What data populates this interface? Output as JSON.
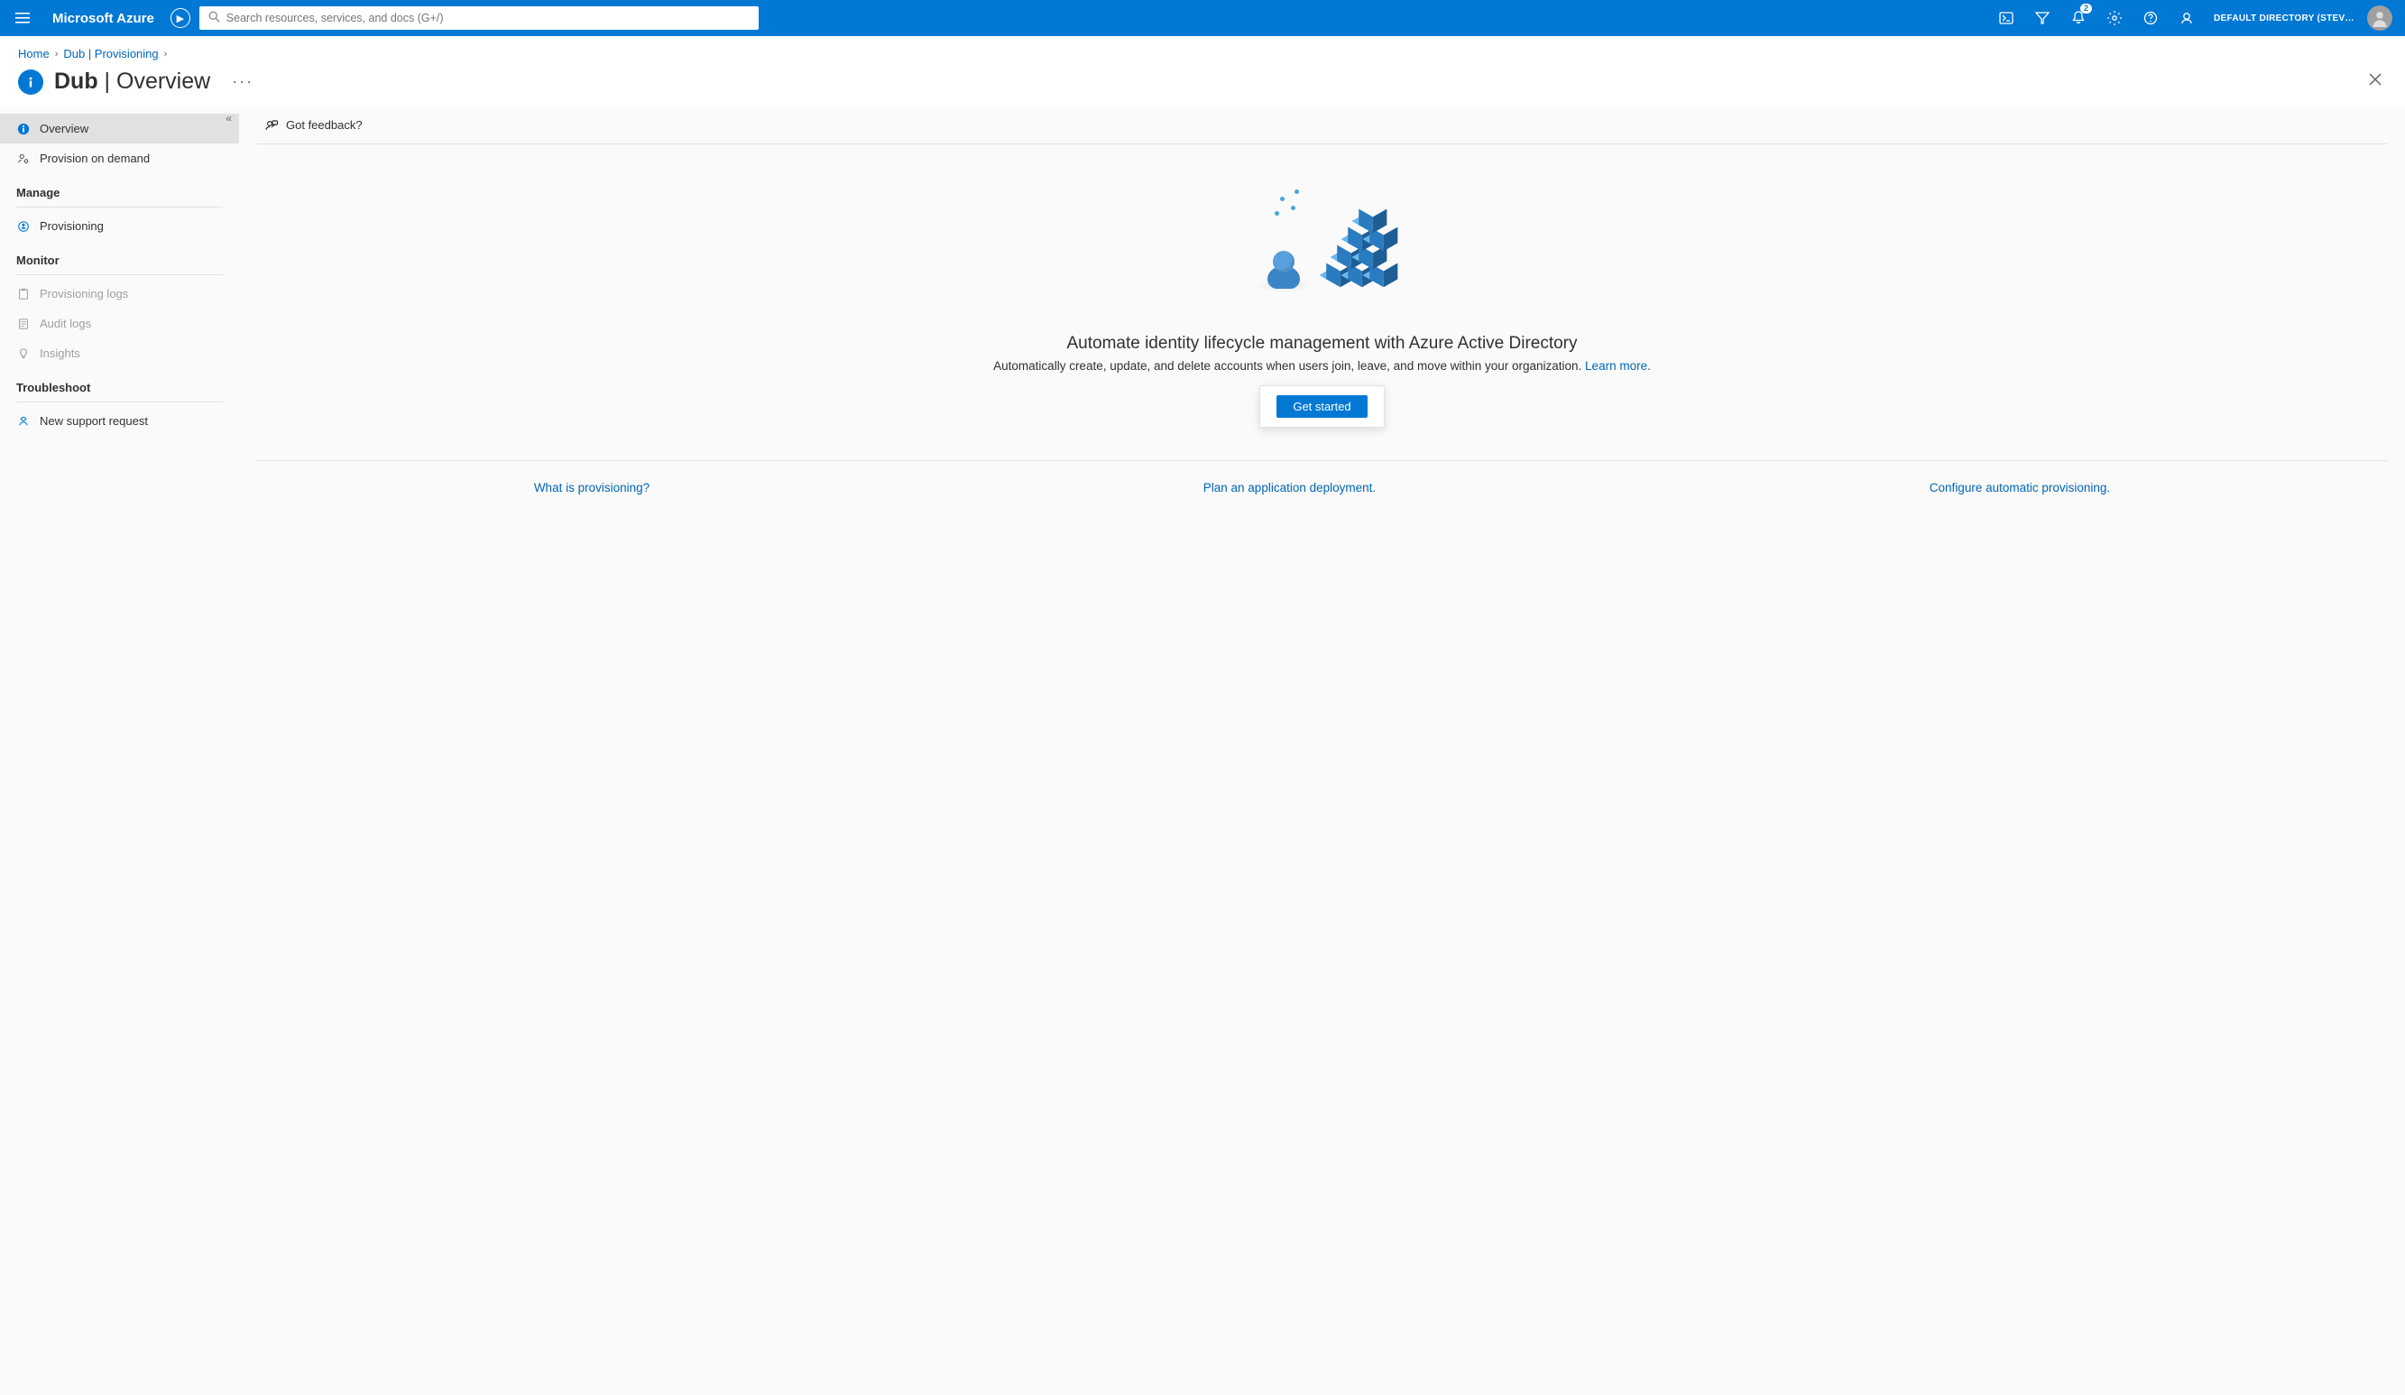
{
  "topbar": {
    "brand": "Microsoft Azure",
    "preview_symbol": "▶",
    "search_placeholder": "Search resources, services, and docs (G+/)",
    "notification_count": "2",
    "tenant_label": "DEFAULT DIRECTORY (STEVEND…"
  },
  "breadcrumb": {
    "items": [
      {
        "label": "Home"
      },
      {
        "label": "Dub | Provisioning"
      }
    ]
  },
  "page": {
    "title_main": "Dub",
    "title_sep": " | ",
    "title_sub": "Overview"
  },
  "sidebar": {
    "groups": [
      {
        "header": null,
        "items": [
          {
            "label": "Overview",
            "active": true,
            "disabled": false,
            "icon": "info"
          },
          {
            "label": "Provision on demand",
            "active": false,
            "disabled": false,
            "icon": "person-gear"
          }
        ]
      },
      {
        "header": "Manage",
        "items": [
          {
            "label": "Provisioning",
            "active": false,
            "disabled": false,
            "icon": "people-sync"
          }
        ]
      },
      {
        "header": "Monitor",
        "items": [
          {
            "label": "Provisioning logs",
            "active": false,
            "disabled": true,
            "icon": "clipboard"
          },
          {
            "label": "Audit logs",
            "active": false,
            "disabled": true,
            "icon": "book"
          },
          {
            "label": "Insights",
            "active": false,
            "disabled": true,
            "icon": "lightbulb"
          }
        ]
      },
      {
        "header": "Troubleshoot",
        "items": [
          {
            "label": "New support request",
            "active": false,
            "disabled": false,
            "icon": "support"
          }
        ]
      }
    ]
  },
  "cmdbar": {
    "feedback_label": "Got feedback?"
  },
  "hero": {
    "title": "Automate identity lifecycle management with Azure Active Directory",
    "subtitle": "Automatically create, update, and delete accounts when users join, leave, and move within your organization. ",
    "learn_more": "Learn more.",
    "get_started": "Get started"
  },
  "links": {
    "what": "What is provisioning?",
    "plan": "Plan an application deployment.",
    "configure": "Configure automatic provisioning."
  }
}
